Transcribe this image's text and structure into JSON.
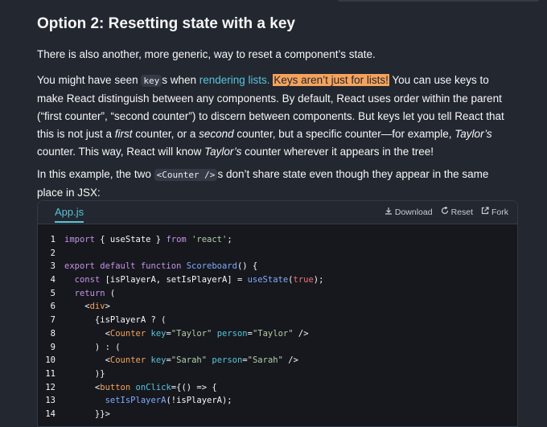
{
  "heading": "Option 2: Resetting state with a key",
  "p1": "There is also another, more generic, way to reset a component’s state.",
  "p2": {
    "a": "You might have seen ",
    "code": "key",
    "b": "s when ",
    "link": "rendering lists.",
    "c": " ",
    "highlight": "Keys aren’t just for lists!",
    "d": " You can use keys to make React distinguish between any components. By default, React uses order within the parent (“first counter”, “second counter”) to discern between components. But keys let you tell React that this is not just a ",
    "em1": "first",
    "e": " counter, or a ",
    "em2": "second",
    "f": " counter, but a specific counter—for example, ",
    "em3": "Taylor’s",
    "g": " counter. This way, React will know ",
    "em4": "Taylor’s",
    "h": " counter wherever it appears in the tree!"
  },
  "p3": {
    "a": "In this example, the two ",
    "code": "<Counter />",
    "b": "s don’t share state even though they appear in the same place in JSX:"
  },
  "sandpack": {
    "tab": "App.js",
    "download": "Download",
    "reset": "Reset",
    "fork": "Fork"
  },
  "code_lines": [
    {
      "n": "1",
      "t": [
        [
          "kw",
          "import"
        ],
        [
          "plain",
          " { useState } "
        ],
        [
          "kw",
          "from"
        ],
        [
          "plain",
          " "
        ],
        [
          "str",
          "'react'"
        ],
        [
          "plain",
          ";"
        ]
      ]
    },
    {
      "n": "2",
      "t": []
    },
    {
      "n": "3",
      "t": [
        [
          "kw",
          "export default function"
        ],
        [
          "plain",
          " "
        ],
        [
          "fn",
          "Scoreboard"
        ],
        [
          "plain",
          "() {"
        ]
      ]
    },
    {
      "n": "4",
      "t": [
        [
          "plain",
          "  "
        ],
        [
          "kw",
          "const"
        ],
        [
          "plain",
          " [isPlayerA, setIsPlayerA] = "
        ],
        [
          "fn",
          "useState"
        ],
        [
          "plain",
          "("
        ],
        [
          "bool",
          "true"
        ],
        [
          "plain",
          ");"
        ]
      ]
    },
    {
      "n": "5",
      "t": [
        [
          "plain",
          "  "
        ],
        [
          "kw",
          "return"
        ],
        [
          "plain",
          " ("
        ]
      ]
    },
    {
      "n": "6",
      "t": [
        [
          "plain",
          "    <"
        ],
        [
          "tag",
          "div"
        ],
        [
          "plain",
          ">"
        ]
      ]
    },
    {
      "n": "7",
      "t": [
        [
          "plain",
          "      {isPlayerA ? ("
        ]
      ]
    },
    {
      "n": "8",
      "t": [
        [
          "plain",
          "        <"
        ],
        [
          "tag",
          "Counter"
        ],
        [
          "plain",
          " "
        ],
        [
          "attr",
          "key"
        ],
        [
          "plain",
          "="
        ],
        [
          "str",
          "\"Taylor\""
        ],
        [
          "plain",
          " "
        ],
        [
          "attr",
          "person"
        ],
        [
          "plain",
          "="
        ],
        [
          "str",
          "\"Taylor\""
        ],
        [
          "plain",
          " />"
        ]
      ]
    },
    {
      "n": "9",
      "t": [
        [
          "plain",
          "      ) : ("
        ]
      ]
    },
    {
      "n": "10",
      "t": [
        [
          "plain",
          "        <"
        ],
        [
          "tag",
          "Counter"
        ],
        [
          "plain",
          " "
        ],
        [
          "attr",
          "key"
        ],
        [
          "plain",
          "="
        ],
        [
          "str",
          "\"Sarah\""
        ],
        [
          "plain",
          " "
        ],
        [
          "attr",
          "person"
        ],
        [
          "plain",
          "="
        ],
        [
          "str",
          "\"Sarah\""
        ],
        [
          "plain",
          " />"
        ]
      ]
    },
    {
      "n": "11",
      "t": [
        [
          "plain",
          "      )}"
        ]
      ]
    },
    {
      "n": "12",
      "t": [
        [
          "plain",
          "      <"
        ],
        [
          "tag",
          "button"
        ],
        [
          "plain",
          " "
        ],
        [
          "attr",
          "onClick"
        ],
        [
          "plain",
          "={() => {"
        ]
      ]
    },
    {
      "n": "13",
      "t": [
        [
          "plain",
          "        "
        ],
        [
          "fn",
          "setIsPlayerA"
        ],
        [
          "plain",
          "(!isPlayerA);"
        ]
      ]
    },
    {
      "n": "14",
      "t": [
        [
          "plain",
          "      }}>"
        ]
      ]
    }
  ]
}
